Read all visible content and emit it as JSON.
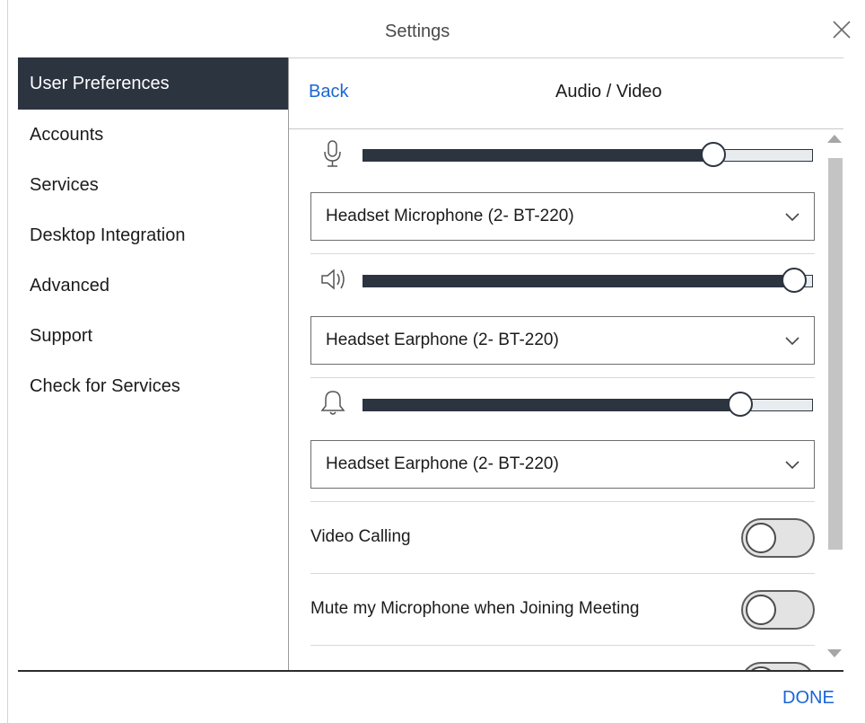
{
  "window": {
    "title": "Settings"
  },
  "sidebar": {
    "items": [
      {
        "label": "User Preferences",
        "active": true
      },
      {
        "label": "Accounts",
        "active": false
      },
      {
        "label": "Services",
        "active": false
      },
      {
        "label": "Desktop Integration",
        "active": false
      },
      {
        "label": "Advanced",
        "active": false
      },
      {
        "label": "Support",
        "active": false
      },
      {
        "label": "Check for Services",
        "active": false
      }
    ]
  },
  "panel": {
    "back_label": "Back",
    "title": "Audio / Video",
    "microphone": {
      "icon": "microphone-icon",
      "level": 0.78,
      "device": "Headset Microphone (2- BT-220)"
    },
    "speaker": {
      "icon": "speaker-icon",
      "level": 0.96,
      "device": "Headset Earphone (2- BT-220)"
    },
    "ringer": {
      "icon": "bell-icon",
      "level": 0.84,
      "device": "Headset Earphone (2- BT-220)"
    },
    "toggles": [
      {
        "label": "Video Calling",
        "on": false
      },
      {
        "label": "Mute my Microphone when Joining Meeting",
        "on": false
      }
    ]
  },
  "footer": {
    "done_label": "DONE"
  },
  "colors": {
    "accent": "#1a66d6",
    "sidebar_active_bg": "#2c3440",
    "slider_fill": "#2c3440"
  }
}
